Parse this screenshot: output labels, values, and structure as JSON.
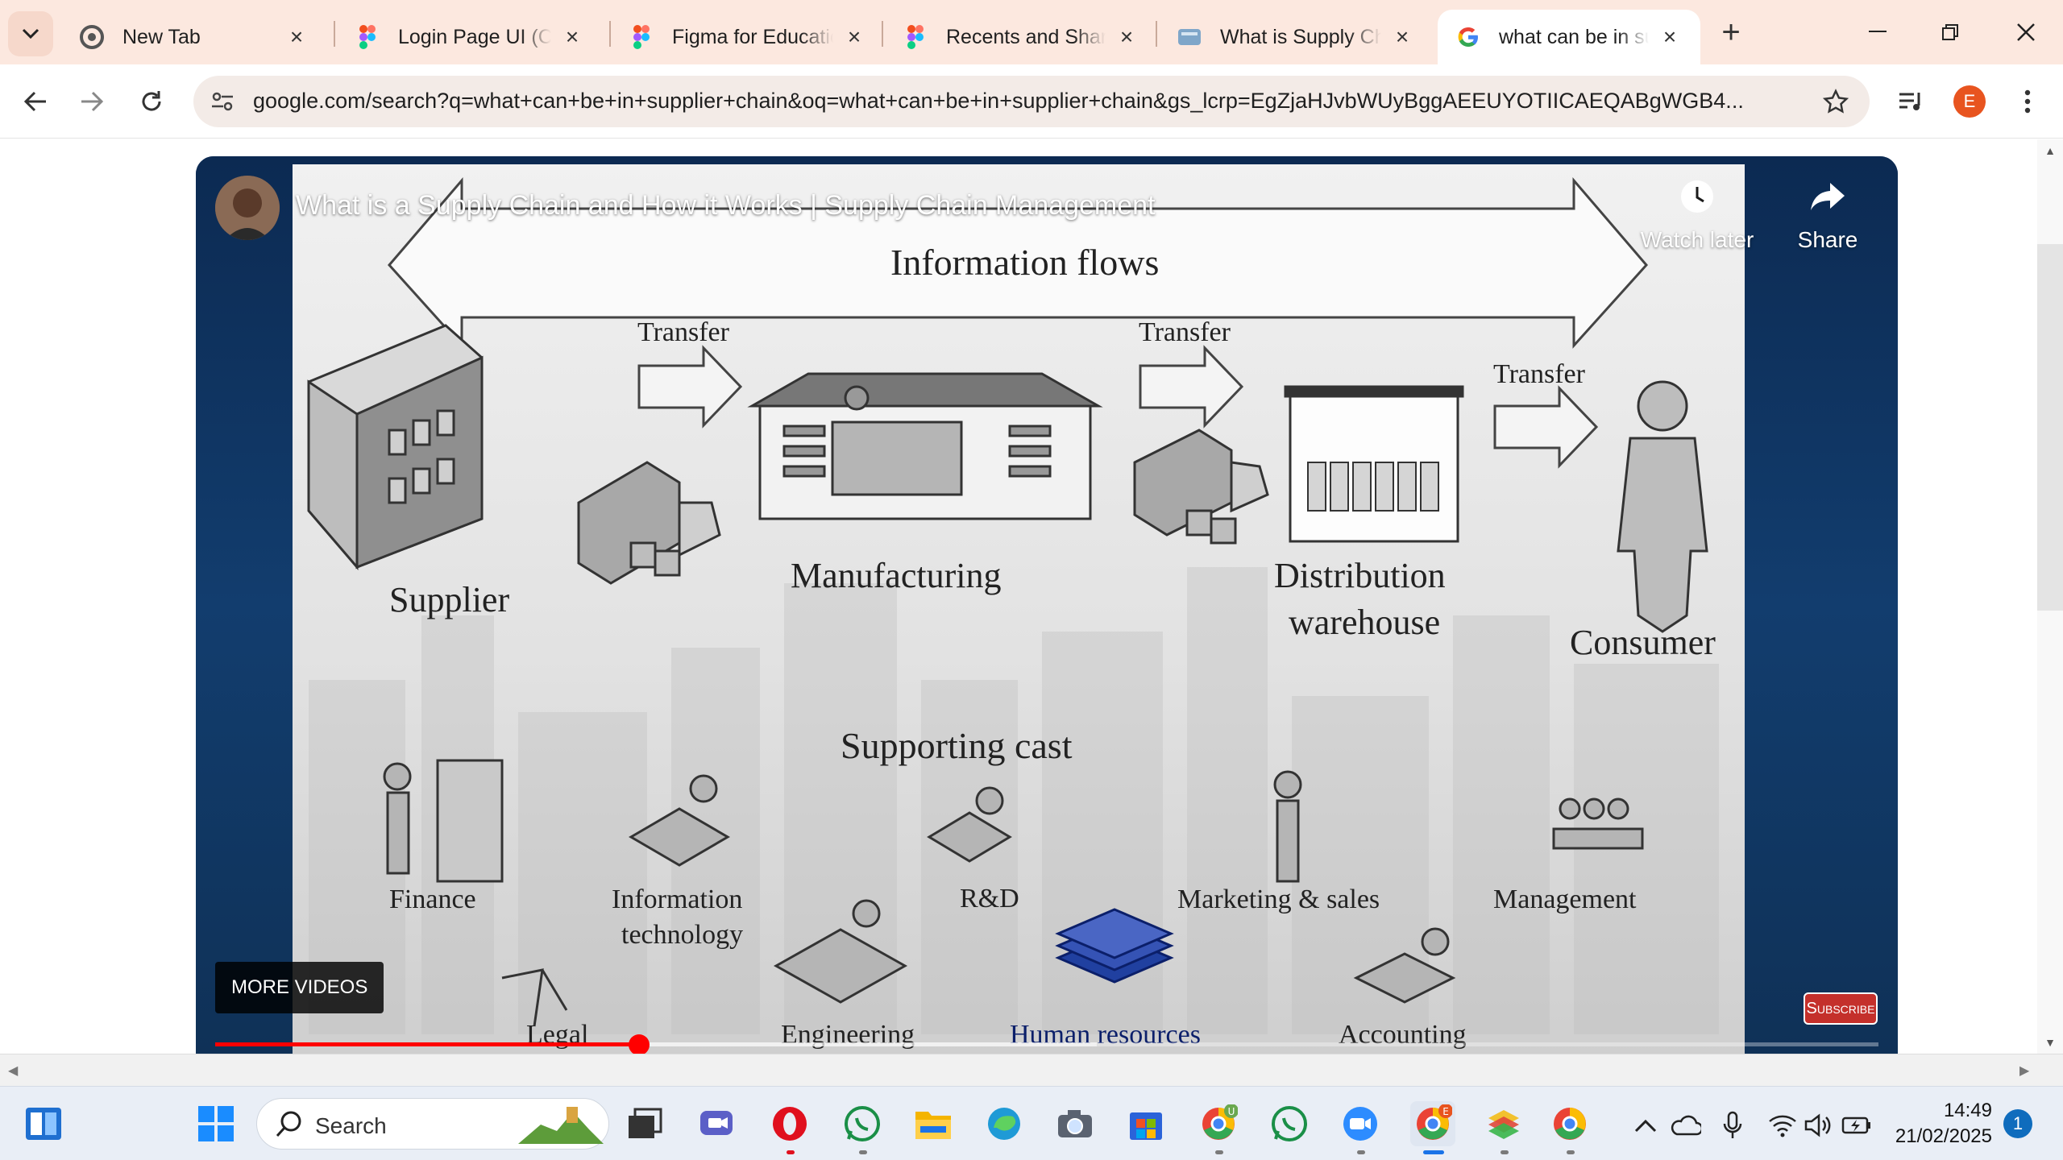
{
  "browser": {
    "tabs": [
      {
        "title": "New Tab",
        "icon": "chrome-icon",
        "active": false
      },
      {
        "title": "Login Page UI (Community)",
        "icon": "figma-icon",
        "active": false
      },
      {
        "title": "Figma for Education",
        "icon": "figma-icon",
        "active": false
      },
      {
        "title": "Recents and Sharing",
        "icon": "figma-icon",
        "active": false
      },
      {
        "title": "What is Supply Chain",
        "icon": "web-icon",
        "active": false
      },
      {
        "title": "what can be in supplier chain",
        "icon": "google-icon",
        "active": true
      }
    ],
    "url": "google.com/search?q=what+can+be+in+supplier+chain&oq=what+can+be+in+supplier+chain&gs_lcrp=EgZjaHJvbWUyBggAEEUYOTIICAEQABgWGB4...",
    "profile_initial": "E",
    "accent_color": "#e8541f"
  },
  "video": {
    "title": "What is a Supply Chain and How it Works | Supply Chain Management",
    "watch_later_label": "Watch later",
    "share_label": "Share",
    "more_videos_label": "MORE VIDEOS",
    "subscribe_label": "Subscribe",
    "progress_fraction": 0.255,
    "buffered_fraction": 0.53,
    "diagram": {
      "top_banner": "Information flows",
      "transfer_labels": [
        "Transfer",
        "Transfer",
        "Transfer"
      ],
      "stages": [
        "Supplier",
        "Manufacturing",
        "Distribution",
        "warehouse",
        "Consumer"
      ],
      "supporting_heading": "Supporting cast",
      "supporting": [
        "Finance",
        "Information",
        "technology",
        "R&D",
        "Marketing & sales",
        "Management"
      ],
      "bottom_row": [
        "Legal",
        "Engineering",
        "Human resources",
        "Accounting"
      ]
    }
  },
  "taskbar": {
    "search_label": "Search",
    "time": "14:49",
    "date": "21/02/2025",
    "notification_count": "1"
  }
}
